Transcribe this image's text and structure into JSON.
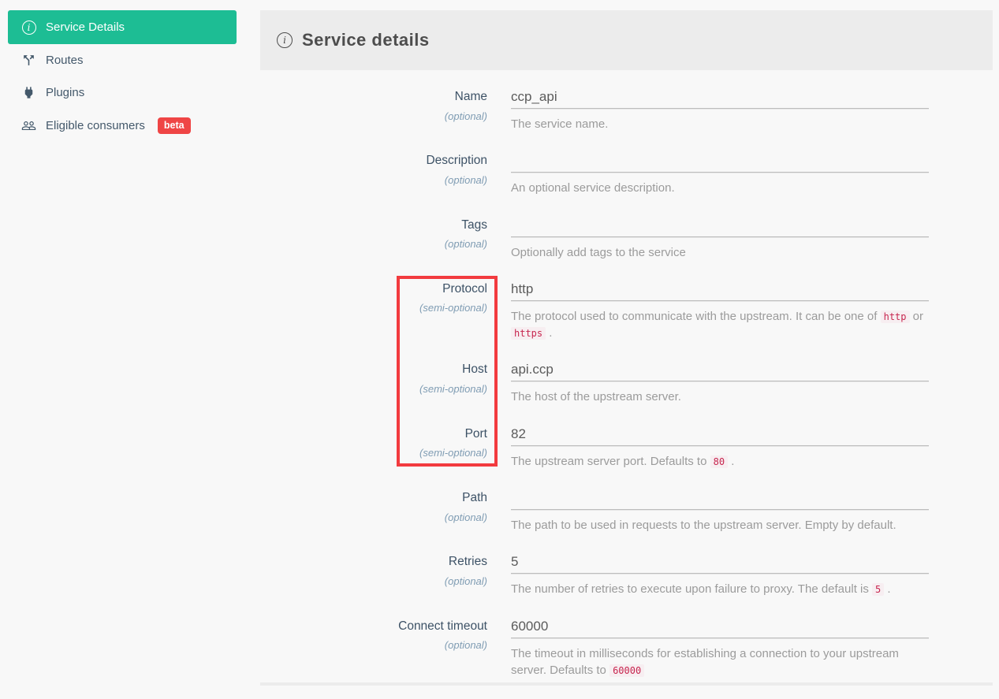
{
  "sidebar": {
    "items": [
      {
        "label": "Service Details",
        "active": true
      },
      {
        "label": "Routes",
        "active": false
      },
      {
        "label": "Plugins",
        "active": false
      },
      {
        "label": "Eligible consumers",
        "active": false,
        "badge": "beta"
      }
    ]
  },
  "header": {
    "title": "Service details"
  },
  "form": {
    "fields": [
      {
        "label": "Name",
        "optionality": "(optional)",
        "value": "ccp_api",
        "help": [
          {
            "text": "The service name."
          }
        ]
      },
      {
        "label": "Description",
        "optionality": "(optional)",
        "value": "",
        "help": [
          {
            "text": "An optional service description."
          }
        ]
      },
      {
        "label": "Tags",
        "optionality": "(optional)",
        "value": "",
        "help": [
          {
            "text": "Optionally add tags to the service"
          }
        ]
      },
      {
        "label": "Protocol",
        "optionality": "(semi-optional)",
        "value": "http",
        "help": [
          {
            "text": "The protocol used to communicate with the upstream. It can be one of "
          },
          {
            "code": "http"
          },
          {
            "text": " or "
          },
          {
            "code": "https"
          },
          {
            "text": " ."
          }
        ]
      },
      {
        "label": "Host",
        "optionality": "(semi-optional)",
        "value": "api.ccp",
        "help": [
          {
            "text": "The host of the upstream server."
          }
        ]
      },
      {
        "label": "Port",
        "optionality": "(semi-optional)",
        "value": "82",
        "help": [
          {
            "text": "The upstream server port. Defaults to "
          },
          {
            "code": "80"
          },
          {
            "text": " ."
          }
        ]
      },
      {
        "label": "Path",
        "optionality": "(optional)",
        "value": "",
        "help": [
          {
            "text": "The path to be used in requests to the upstream server. Empty by default."
          }
        ]
      },
      {
        "label": "Retries",
        "optionality": "(optional)",
        "value": "5",
        "help": [
          {
            "text": "The number of retries to execute upon failure to proxy. The default is "
          },
          {
            "code": "5"
          },
          {
            "text": " ."
          }
        ]
      },
      {
        "label": "Connect timeout",
        "optionality": "(optional)",
        "value": "60000",
        "help": [
          {
            "text": "The timeout in milliseconds for establishing a connection to your upstream server. Defaults to "
          },
          {
            "code": "60000"
          }
        ]
      }
    ]
  },
  "colors": {
    "accent_teal": "#1dbd94",
    "badge_red": "#ef4545",
    "annotation_red": "#f23b3f",
    "code_text": "#c7254e",
    "code_bg": "#f7eef1",
    "header_bar": "#ececec",
    "page_bg": "#f8f8f8"
  }
}
